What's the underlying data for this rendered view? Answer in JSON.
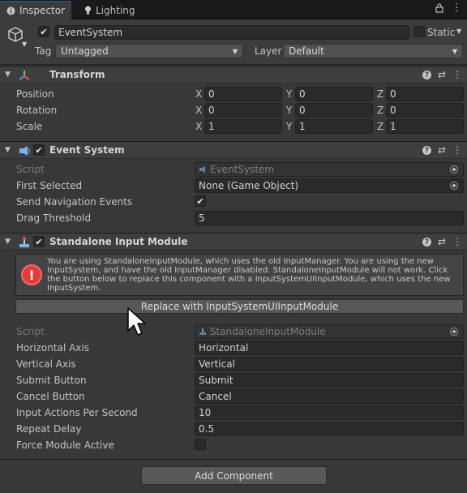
{
  "tabs": [
    {
      "label": "Inspector",
      "icon": "info-icon",
      "active": true
    },
    {
      "label": "Lighting",
      "icon": "bulb-icon",
      "active": false
    }
  ],
  "object": {
    "name": "EventSystem",
    "active": true,
    "static_label": "Static",
    "tag_label": "Tag",
    "tag_value": "Untagged",
    "layer_label": "Layer",
    "layer_value": "Default"
  },
  "transform": {
    "title": "Transform",
    "rows": [
      {
        "label": "Position",
        "x": "0",
        "y": "0",
        "z": "0"
      },
      {
        "label": "Rotation",
        "x": "0",
        "y": "0",
        "z": "0"
      },
      {
        "label": "Scale",
        "x": "1",
        "y": "1",
        "z": "1"
      }
    ],
    "axes": [
      "X",
      "Y",
      "Z"
    ]
  },
  "event_system": {
    "title": "Event System",
    "enabled": true,
    "script_label": "Script",
    "script_value": "EventSystem",
    "first_selected_label": "First Selected",
    "first_selected_value": "None (Game Object)",
    "send_nav_label": "Send Navigation Events",
    "send_nav_checked": true,
    "drag_label": "Drag Threshold",
    "drag_value": "5"
  },
  "standalone": {
    "title": "Standalone Input Module",
    "enabled": true,
    "warning": "You are using StandaloneInputModule, which uses the old InputManager. You are using the new InputSystem, and have the old InputManager disabled. StandaloneInputModule will not work. Click the button below to replace this component with a InputSystemUIInputModule, which uses the new InputSystem.",
    "replace_button": "Replace with InputSystemUIInputModule",
    "script_label": "Script",
    "script_value": "StandaloneInputModule",
    "rows": [
      {
        "label": "Horizontal Axis",
        "value": "Horizontal"
      },
      {
        "label": "Vertical Axis",
        "value": "Vertical"
      },
      {
        "label": "Submit Button",
        "value": "Submit"
      },
      {
        "label": "Cancel Button",
        "value": "Cancel"
      },
      {
        "label": "Input Actions Per Second",
        "value": "10"
      },
      {
        "label": "Repeat Delay",
        "value": "0.5"
      }
    ],
    "force_label": "Force Module Active",
    "force_checked": false
  },
  "add_component": "Add Component",
  "colors": {
    "background": "#383838",
    "header": "#3e3e3e",
    "field": "#2a2a2a",
    "accent_tab": "#2c5d87",
    "error": "#e23b3b"
  }
}
